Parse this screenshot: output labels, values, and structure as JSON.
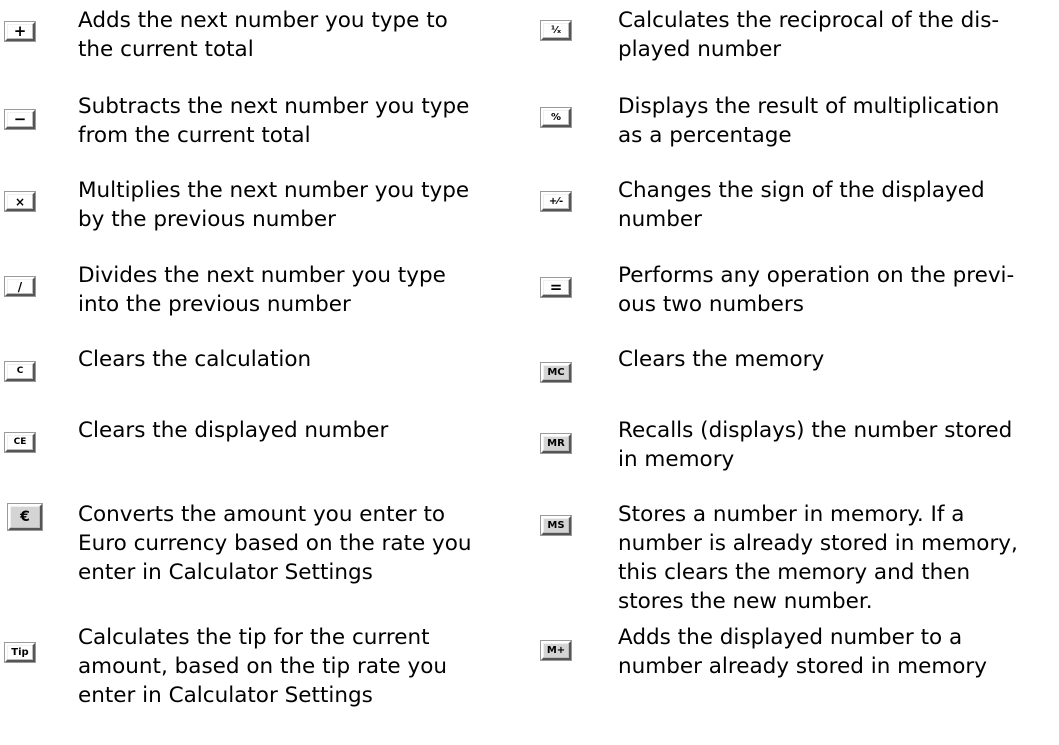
{
  "left_column": [
    {
      "button": {
        "label": "+",
        "icon": "plus-icon"
      },
      "lines": [
        "Adds the next number you type to",
        "the current total"
      ]
    },
    {
      "button": {
        "label": "−",
        "icon": "minus-icon"
      },
      "lines": [
        "Subtracts the next number you type",
        "from the current total"
      ]
    },
    {
      "button": {
        "label": "×",
        "icon": "multiply-icon"
      },
      "lines": [
        "Multiplies the next number you type",
        "by the previous number"
      ]
    },
    {
      "button": {
        "label": "/",
        "icon": "divide-icon"
      },
      "lines": [
        "Divides the next number you type",
        "into the previous number"
      ]
    },
    {
      "button": {
        "label": "C"
      },
      "lines": [
        "Clears the calculation"
      ]
    },
    {
      "button": {
        "label": "CE"
      },
      "lines": [
        "Clears the displayed number"
      ]
    },
    {
      "button": {
        "label": "€",
        "icon": "euro-icon"
      },
      "lines": [
        "Converts the amount you enter to",
        "Euro currency based on the rate you",
        "enter in Calculator Settings"
      ]
    },
    {
      "button": {
        "label": "Tip"
      },
      "lines": [
        "Calculates the tip for the current",
        "amount, based on the tip rate you",
        "enter in Calculator Settings"
      ]
    }
  ],
  "right_column": [
    {
      "button": {
        "label": "¹⁄ₓ",
        "icon": "reciprocal-icon"
      },
      "lines": [
        "Calculates the reciprocal of the dis-",
        "played number"
      ]
    },
    {
      "button": {
        "label": "%",
        "icon": "percent-icon"
      },
      "lines": [
        "Displays the result of multiplication",
        "as a percentage"
      ]
    },
    {
      "button": {
        "label": "+⁄-",
        "icon": "plus-minus-icon"
      },
      "lines": [
        "Changes the sign of the displayed",
        "number"
      ]
    },
    {
      "button": {
        "label": "=",
        "icon": "equals-icon"
      },
      "lines": [
        "Performs any operation on the previ-",
        "ous two numbers"
      ]
    },
    {
      "button": {
        "label": "MC"
      },
      "lines": [
        "Clears the memory"
      ]
    },
    {
      "button": {
        "label": "MR"
      },
      "lines": [
        "Recalls (displays) the number stored",
        "in memory"
      ]
    },
    {
      "button": {
        "label": "MS"
      },
      "lines": [
        "Stores a number in memory. If a",
        "number is already stored in memory,",
        "this clears the memory and then",
        "stores the new number."
      ]
    },
    {
      "button": {
        "label": "M+"
      },
      "lines": [
        "Adds the displayed number to a",
        "number already stored in memory"
      ]
    }
  ]
}
